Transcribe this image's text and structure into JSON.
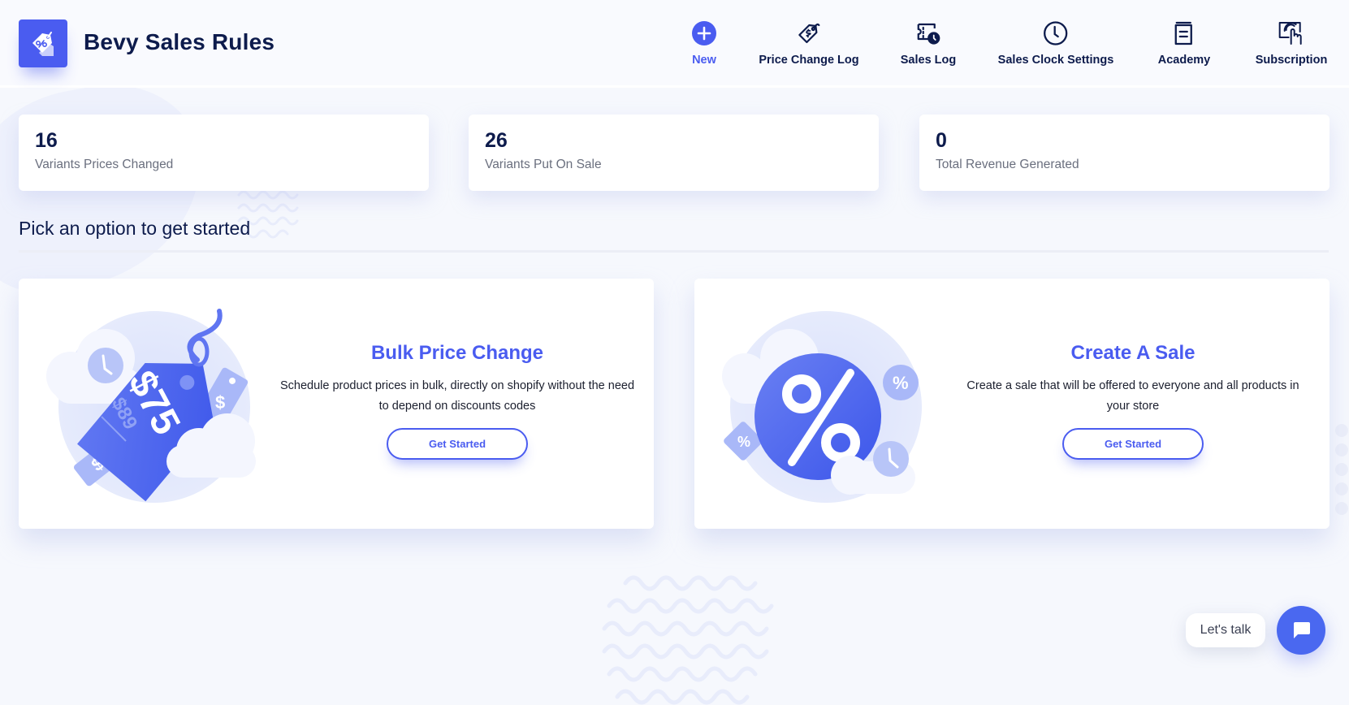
{
  "app": {
    "title": "Bevy Sales Rules",
    "logo_icon": "percent-tag-icon"
  },
  "nav": [
    {
      "label": "New",
      "icon": "plus-circle-icon",
      "active": true
    },
    {
      "label": "Price Change Log",
      "icon": "price-tag-dollar-icon"
    },
    {
      "label": "Sales Log",
      "icon": "ticket-clock-icon"
    },
    {
      "label": "Sales Clock Settings",
      "icon": "clock-icon"
    },
    {
      "label": "Academy",
      "icon": "book-icon"
    },
    {
      "label": "Subscription",
      "icon": "touch-screen-icon"
    }
  ],
  "stats": [
    {
      "value": "16",
      "label": "Variants Prices Changed"
    },
    {
      "value": "26",
      "label": "Variants Put On Sale"
    },
    {
      "value": "0",
      "label": "Total Revenue Generated"
    }
  ],
  "section": {
    "title": "Pick an option to get started"
  },
  "options": [
    {
      "title": "Bulk Price Change",
      "description": "Schedule product prices in bulk, directly on shopify without the need to depend on discounts codes",
      "button": "Get Started",
      "illustration": {
        "new_price": "$75",
        "old_price": "$89",
        "icon": "price-tag-illustration"
      }
    },
    {
      "title": "Create A Sale",
      "description": "Create a sale that will be offered to everyone and all products in your store",
      "button": "Get Started",
      "illustration": {
        "symbol": "%",
        "icon": "percent-illustration"
      }
    }
  ],
  "chat": {
    "label": "Let's talk",
    "icon": "chat-bubble-icon"
  },
  "colors": {
    "accent": "#4a5cf0",
    "text_dark": "#0d1b4c",
    "text_muted": "#6a6f7e",
    "background": "#f6f8fd"
  }
}
